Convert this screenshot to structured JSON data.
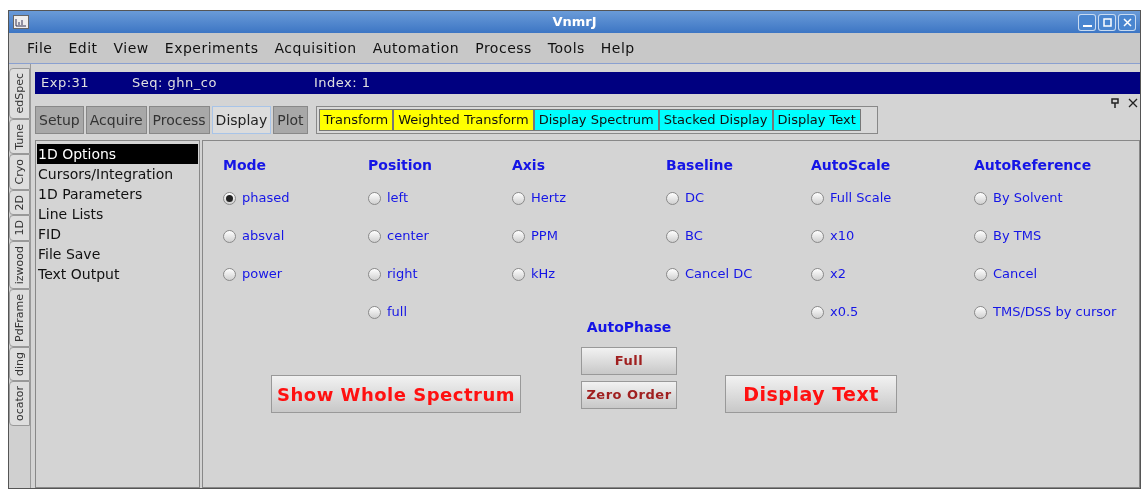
{
  "window": {
    "title": "VnmrJ"
  },
  "menu": [
    "File",
    "Edit",
    "View",
    "Experiments",
    "Acquisition",
    "Automation",
    "Process",
    "Tools",
    "Help"
  ],
  "info_bar": {
    "exp": "Exp:31",
    "seq": "Seq: ghn_co",
    "index": "Index: 1"
  },
  "side_tabs": [
    "edSpec",
    "Tune",
    "Cryo",
    "2D",
    "1D",
    "izwood",
    "PdFrame",
    "ding",
    "ocator"
  ],
  "tabs": [
    {
      "label": "Setup",
      "selected": false
    },
    {
      "label": "Acquire",
      "selected": false
    },
    {
      "label": "Process",
      "selected": false
    },
    {
      "label": "Display",
      "selected": true
    },
    {
      "label": "Plot",
      "selected": false
    }
  ],
  "toolbar": [
    {
      "label": "Transform",
      "color": "#ffff00"
    },
    {
      "label": "Weighted Transform",
      "color": "#ffff00"
    },
    {
      "label": "Display Spectrum",
      "color": "#00ffff"
    },
    {
      "label": "Stacked Display",
      "color": "#00ffff"
    },
    {
      "label": "Display Text",
      "color": "#00ffff"
    }
  ],
  "options_list": [
    {
      "label": "1D Options",
      "selected": true
    },
    {
      "label": "Cursors/Integration",
      "selected": false
    },
    {
      "label": "1D Parameters",
      "selected": false
    },
    {
      "label": "Line Lists",
      "selected": false
    },
    {
      "label": "FID",
      "selected": false
    },
    {
      "label": "File Save",
      "selected": false
    },
    {
      "label": "Text Output",
      "selected": false
    }
  ],
  "groups": [
    {
      "title": "Mode",
      "options": [
        {
          "label": "phased",
          "selected": true
        },
        {
          "label": "absval",
          "selected": false
        },
        {
          "label": "power",
          "selected": false
        }
      ]
    },
    {
      "title": "Position",
      "options": [
        {
          "label": "left",
          "selected": false
        },
        {
          "label": "center",
          "selected": false
        },
        {
          "label": "right",
          "selected": false
        },
        {
          "label": "full",
          "selected": false
        }
      ]
    },
    {
      "title": "Axis",
      "options": [
        {
          "label": "Hertz",
          "selected": false
        },
        {
          "label": "PPM",
          "selected": false
        },
        {
          "label": "kHz",
          "selected": false
        }
      ]
    },
    {
      "title": "Baseline",
      "options": [
        {
          "label": "DC",
          "selected": false
        },
        {
          "label": "BC",
          "selected": false
        },
        {
          "label": "Cancel DC",
          "selected": false
        }
      ]
    },
    {
      "title": "AutoScale",
      "options": [
        {
          "label": "Full Scale",
          "selected": false
        },
        {
          "label": "x10",
          "selected": false
        },
        {
          "label": "x2",
          "selected": false
        },
        {
          "label": "x0.5",
          "selected": false
        }
      ]
    },
    {
      "title": "AutoReference",
      "options": [
        {
          "label": "By Solvent",
          "selected": false
        },
        {
          "label": "By TMS",
          "selected": false
        },
        {
          "label": "Cancel",
          "selected": false
        },
        {
          "label": "TMS/DSS by cursor",
          "selected": false
        }
      ]
    }
  ],
  "autophase": {
    "title": "AutoPhase",
    "buttons": [
      "Full",
      "Zero Order"
    ]
  },
  "actions": [
    "Show Whole Spectrum",
    "Display Text"
  ]
}
